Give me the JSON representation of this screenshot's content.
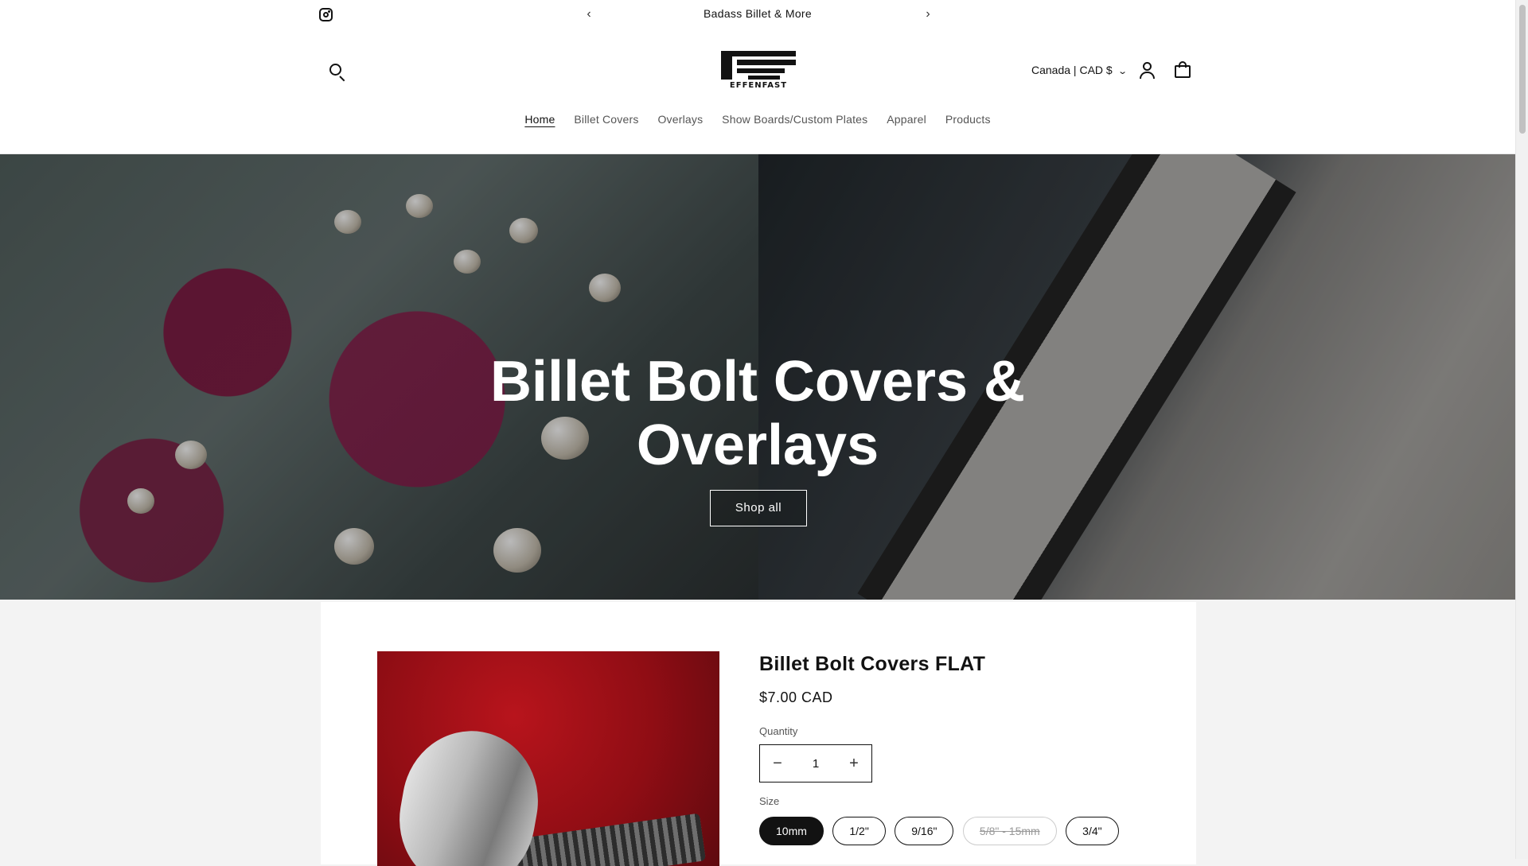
{
  "announcement": {
    "message": "Badass Billet & More",
    "prev_icon": "chevron-left-icon",
    "next_icon": "chevron-right-icon",
    "social_icon": "instagram-icon"
  },
  "header": {
    "logo_text": "EFFENFAST",
    "country_selector": "Canada | CAD $",
    "nav": [
      "Home",
      "Billet Covers",
      "Overlays",
      "Show Boards/Custom Plates",
      "Apparel",
      "Products"
    ],
    "active_nav": "Home"
  },
  "hero": {
    "title": "Billet Bolt Covers & Overlays",
    "button": "Shop all"
  },
  "product": {
    "title": "Billet Bolt Covers FLAT",
    "price": "$7.00 CAD",
    "quantity_label": "Quantity",
    "quantity_value": "1",
    "size_label": "Size",
    "sizes": [
      {
        "label": "10mm",
        "state": "selected"
      },
      {
        "label": "1/2\"",
        "state": "available"
      },
      {
        "label": "9/16\"",
        "state": "available"
      },
      {
        "label": "5/8\" - 15mm",
        "state": "sold-out"
      },
      {
        "label": "3/4\"",
        "state": "available"
      }
    ]
  },
  "colors": {
    "text": "#121212",
    "background": "#f3f3f3",
    "hero_text": "#ffffff"
  }
}
